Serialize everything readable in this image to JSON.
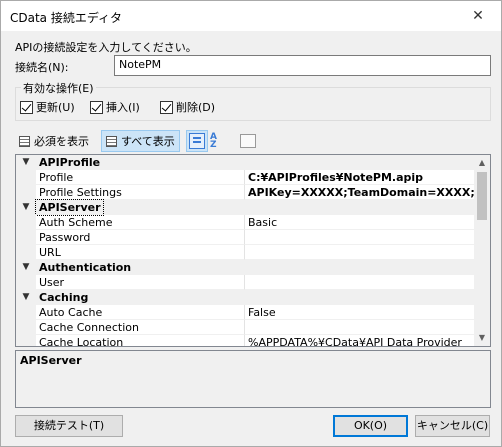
{
  "window": {
    "title": "CData 接続エディタ",
    "close_glyph": "✕"
  },
  "intro": "APIの接続設定を入力してください。",
  "connection": {
    "label": "接続名(N):",
    "value": "NotePM"
  },
  "operations": {
    "legend": "有効な操作(E)",
    "items": [
      {
        "label": "更新(U)",
        "checked": true
      },
      {
        "label": "挿入(I)",
        "checked": true
      },
      {
        "label": "削除(D)",
        "checked": true
      }
    ]
  },
  "toolbar": {
    "required_label": "必須を表示",
    "show_all_label": "すべて表示"
  },
  "grid": {
    "rows": [
      {
        "type": "category",
        "name": "APIProfile",
        "expander": "▼"
      },
      {
        "type": "prop",
        "name": "Profile",
        "value": "C:¥APIProfiles¥NotePM.apip",
        "bold": true
      },
      {
        "type": "prop",
        "name": "Profile Settings",
        "value": "APIKey=XXXXX;TeamDomain=XXXX;",
        "bold": true
      },
      {
        "type": "category",
        "name": "APIServer",
        "expander": "▼",
        "selected": true
      },
      {
        "type": "prop",
        "name": "Auth Scheme",
        "value": "Basic",
        "bold": false
      },
      {
        "type": "prop",
        "name": "Password",
        "value": "",
        "bold": false
      },
      {
        "type": "prop",
        "name": "URL",
        "value": "",
        "bold": false
      },
      {
        "type": "category",
        "name": "Authentication",
        "expander": "▼"
      },
      {
        "type": "prop",
        "name": "User",
        "value": "",
        "bold": false
      },
      {
        "type": "category",
        "name": "Caching",
        "expander": "▼"
      },
      {
        "type": "prop",
        "name": "Auto Cache",
        "value": "False",
        "bold": false
      },
      {
        "type": "prop",
        "name": "Cache Connection",
        "value": "",
        "bold": false
      },
      {
        "type": "prop",
        "name": "Cache Location",
        "value": "%APPDATA%¥CData¥API Data Provider",
        "bold": false
      }
    ]
  },
  "description": {
    "title": "APIServer"
  },
  "buttons": {
    "test": "接続テスト(T)",
    "ok": "OK(O)",
    "cancel": "キャンセル(C)"
  }
}
